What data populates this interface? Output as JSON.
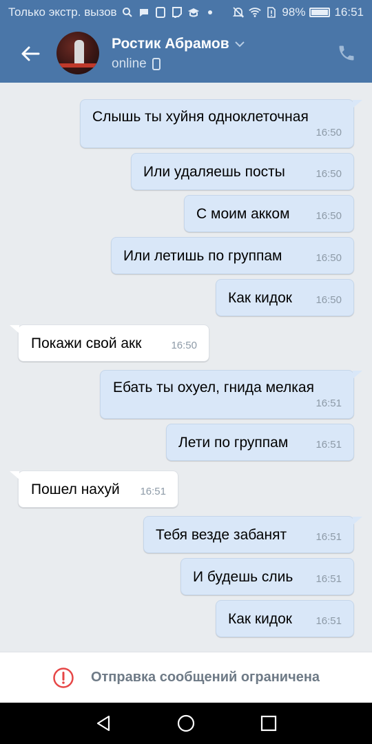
{
  "status_bar": {
    "carrier_text": "Только экстр. вызов",
    "battery": "98%",
    "time": "16:51"
  },
  "header": {
    "contact_name": "Ростик Абрамов",
    "status": "online"
  },
  "chat": {
    "date_fragment": "",
    "messages": [
      {
        "direction": "out",
        "text": "Слышь ты хуйня одноклеточная",
        "time": "16:50"
      },
      {
        "direction": "out",
        "text": "Или удаляешь посты",
        "time": "16:50"
      },
      {
        "direction": "out",
        "text": "С моим акком",
        "time": "16:50"
      },
      {
        "direction": "out",
        "text": "Или летишь по группам",
        "time": "16:50"
      },
      {
        "direction": "out",
        "text": "Как кидок",
        "time": "16:50"
      },
      {
        "direction": "in",
        "text": "Покажи свой акк",
        "time": "16:50"
      },
      {
        "direction": "out",
        "text": "Ебать ты охуел, гнида мелкая",
        "time": "16:51"
      },
      {
        "direction": "out",
        "text": "Лети по группам",
        "time": "16:51"
      },
      {
        "direction": "in",
        "text": "Пошел нахуй",
        "time": "16:51"
      },
      {
        "direction": "out",
        "text": "Тебя везде забанят",
        "time": "16:51"
      },
      {
        "direction": "out",
        "text": "И будешь слиь",
        "time": "16:51"
      },
      {
        "direction": "out",
        "text": "Как кидок",
        "time": "16:51"
      }
    ]
  },
  "restriction": {
    "text": "Отправка сообщений ограничена"
  },
  "colors": {
    "header_bg": "#4a76a8",
    "outgoing_bubble": "#d9e7f8",
    "incoming_bubble": "#ffffff",
    "chat_bg": "#e9ecef",
    "warning_red": "#e64646"
  }
}
